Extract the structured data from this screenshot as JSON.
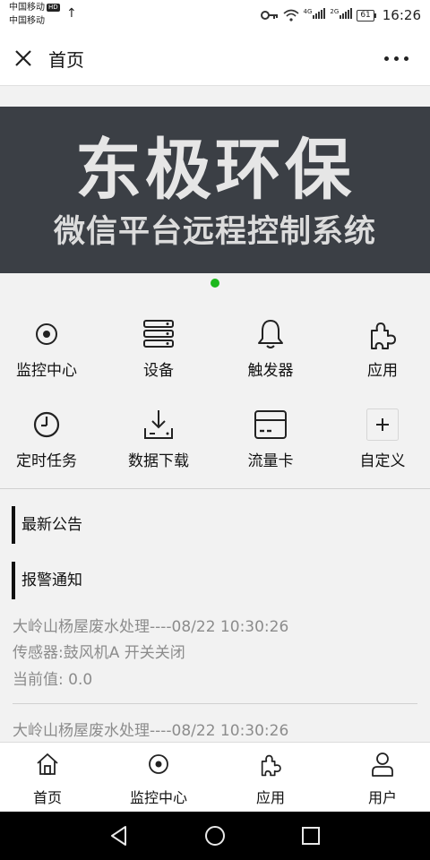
{
  "status_bar": {
    "carrier_1": "中国移动",
    "carrier_1_badge": "HD",
    "carrier_2": "中国移动",
    "signal_1_label": "4G",
    "signal_2_label": "2G",
    "battery": "61",
    "time": "16:26"
  },
  "titlebar": {
    "title": "首页"
  },
  "banner": {
    "title": "东极环保",
    "subtitle": "微信平台远程控制系统",
    "active_dot_color": "#1cb81c"
  },
  "grid": [
    {
      "label": "监控中心",
      "icon": "target-icon"
    },
    {
      "label": "设备",
      "icon": "server-icon"
    },
    {
      "label": "触发器",
      "icon": "bell-icon"
    },
    {
      "label": "应用",
      "icon": "puzzle-icon"
    },
    {
      "label": "定时任务",
      "icon": "clock-icon"
    },
    {
      "label": "数据下载",
      "icon": "download-icon"
    },
    {
      "label": "流量卡",
      "icon": "sim-card-icon"
    },
    {
      "label": "自定义",
      "icon": "plus-icon"
    }
  ],
  "sections": {
    "announcements": "最新公告",
    "alarms": "报警通知"
  },
  "alerts": [
    {
      "title": "大岭山杨屋废水处理----08/22 10:30:26",
      "sensor": "传感器:鼓风机A 开关关闭",
      "value": "当前值: 0.0"
    },
    {
      "title": "大岭山杨屋废水处理----08/22 10:30:26"
    }
  ],
  "tabbar": [
    {
      "label": "首页",
      "icon": "home-icon"
    },
    {
      "label": "监控中心",
      "icon": "target-icon"
    },
    {
      "label": "应用",
      "icon": "puzzle-icon"
    },
    {
      "label": "用户",
      "icon": "user-icon"
    }
  ],
  "colors": {
    "banner_bg": "#3b3f45",
    "alert_text": "#8c8c8c",
    "accent_bar": "#111111"
  }
}
